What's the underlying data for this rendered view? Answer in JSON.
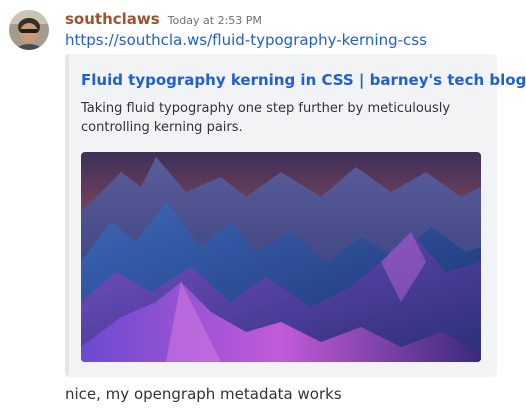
{
  "message": {
    "author": "southclaws",
    "timestamp": "Today at 2:53 PM",
    "link_text": "https://southcla.ws/fluid-typography-kerning-css",
    "followup_text": "nice, my opengraph metadata works"
  },
  "embed": {
    "title": "Fluid typography kerning in CSS | barney's tech blog",
    "description": "Taking fluid typography one step further by meticulously controlling kerning pairs."
  },
  "colors": {
    "username": "#a0542b",
    "link": "#1f5fd1",
    "embed_background": "#f2f3f5",
    "embed_border": "#e3e5e8"
  }
}
